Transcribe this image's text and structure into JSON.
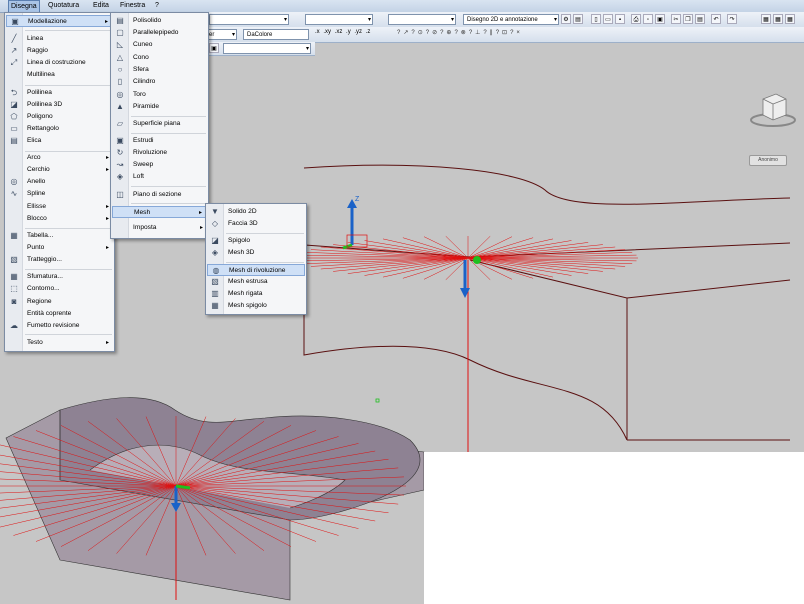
{
  "menubar": {
    "items": [
      "Disegna",
      "Quotatura",
      "Edita",
      "Finestra",
      "?"
    ]
  },
  "toolbar": {
    "layer_combo": "er",
    "color_combo": "DaColore",
    "workspace_combo": "Disegno 2D e annotazione",
    "filter_buttons": [
      ".x",
      ".xy",
      ".xz",
      ".y",
      ".yz",
      ".z"
    ]
  },
  "disegna_menu": {
    "items": [
      {
        "label": "Modellazione",
        "icon": "cube-icon",
        "submenu": true
      },
      {
        "label": "Linea",
        "icon": "line-icon"
      },
      {
        "label": "Raggio",
        "icon": "ray-icon"
      },
      {
        "label": "Linea di costruzione",
        "icon": "xline-icon"
      },
      {
        "label": "Multilinea",
        "icon": "multiline-icon"
      },
      {
        "label": "Polilinea",
        "icon": "polyline-icon"
      },
      {
        "label": "Polilinea 3D",
        "icon": "polyline3d-icon"
      },
      {
        "label": "Poligono",
        "icon": "polygon-icon"
      },
      {
        "label": "Rettangolo",
        "icon": "rectangle-icon"
      },
      {
        "label": "Elica",
        "icon": "helix-icon"
      },
      {
        "label": "Arco",
        "icon": "",
        "submenu": true
      },
      {
        "label": "Cerchio",
        "icon": "",
        "submenu": true
      },
      {
        "label": "Anello",
        "icon": "donut-icon"
      },
      {
        "label": "Spline",
        "icon": "spline-icon"
      },
      {
        "label": "Ellisse",
        "icon": "",
        "submenu": true
      },
      {
        "label": "Blocco",
        "icon": "",
        "submenu": true
      },
      {
        "label": "Tabella...",
        "icon": "table-icon"
      },
      {
        "label": "Punto",
        "icon": "",
        "submenu": true
      },
      {
        "label": "Tratteggio...",
        "icon": "hatch-icon"
      },
      {
        "label": "Sfumatura...",
        "icon": "gradient-icon"
      },
      {
        "label": "Contorno...",
        "icon": "boundary-icon"
      },
      {
        "label": "Regione",
        "icon": "region-icon"
      },
      {
        "label": "Entità coprente",
        "icon": ""
      },
      {
        "label": "Fumetto revisione",
        "icon": "revcloud-icon"
      },
      {
        "label": "Testo",
        "icon": "",
        "submenu": true
      }
    ]
  },
  "modellazione_menu": {
    "items": [
      {
        "label": "Polisolido",
        "icon": "polysolid-icon"
      },
      {
        "label": "Parallelepipedo",
        "icon": "box-icon"
      },
      {
        "label": "Cuneo",
        "icon": "wedge-icon"
      },
      {
        "label": "Cono",
        "icon": "cone-icon"
      },
      {
        "label": "Sfera",
        "icon": "sphere-icon"
      },
      {
        "label": "Cilindro",
        "icon": "cylinder-icon"
      },
      {
        "label": "Toro",
        "icon": "torus-icon"
      },
      {
        "label": "Piramide",
        "icon": "pyramid-icon"
      },
      {
        "label": "Superficie piana",
        "icon": "planar-surface-icon"
      },
      {
        "label": "Estrudi",
        "icon": "extrude-icon"
      },
      {
        "label": "Rivoluzione",
        "icon": "revolve-icon"
      },
      {
        "label": "Sweep",
        "icon": "sweep-icon"
      },
      {
        "label": "Loft",
        "icon": "loft-icon"
      },
      {
        "label": "Piano di sezione",
        "icon": "section-plane-icon"
      },
      {
        "label": "Mesh",
        "icon": "",
        "submenu": true
      },
      {
        "label": "Imposta",
        "icon": "",
        "submenu": true
      }
    ]
  },
  "mesh_menu": {
    "items": [
      {
        "label": "Solido 2D",
        "icon": "solid2d-icon"
      },
      {
        "label": "Faccia 3D",
        "icon": "face3d-icon"
      },
      {
        "label": "Spigolo",
        "icon": "edge-icon"
      },
      {
        "label": "Mesh 3D",
        "icon": "mesh3d-icon"
      },
      {
        "label": "Mesh di rivoluzione",
        "icon": "revsurf-icon"
      },
      {
        "label": "Mesh estrusa",
        "icon": "tabsurf-icon"
      },
      {
        "label": "Mesh rigata",
        "icon": "rulesurf-icon"
      },
      {
        "label": "Mesh spigolo",
        "icon": "edgesurf-icon"
      }
    ]
  },
  "viewport": {
    "ucs_z_label": "Z",
    "nav_button": "Anonimo"
  },
  "colors": {
    "canvas": "#c6c6c6",
    "wire_red": "#e01010",
    "axis_blue": "#1a62c8",
    "axis_green": "#1fbf1f",
    "solid_face": "#8e8293"
  }
}
